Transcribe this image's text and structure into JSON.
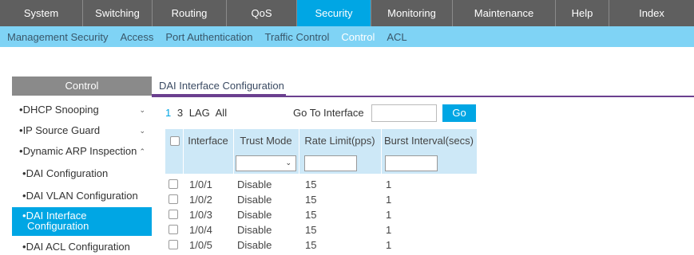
{
  "topnav": {
    "tabs": [
      {
        "label": "System"
      },
      {
        "label": "Switching"
      },
      {
        "label": "Routing"
      },
      {
        "label": "QoS"
      },
      {
        "label": "Security"
      },
      {
        "label": "Monitoring"
      },
      {
        "label": "Maintenance"
      },
      {
        "label": "Help"
      },
      {
        "label": "Index"
      }
    ],
    "active": "Security"
  },
  "subnav": {
    "items": [
      {
        "label": "Management Security"
      },
      {
        "label": "Access"
      },
      {
        "label": "Port Authentication"
      },
      {
        "label": "Traffic Control"
      },
      {
        "label": "Control"
      },
      {
        "label": "ACL"
      }
    ],
    "active": "Control"
  },
  "sidebar": {
    "header": "Control",
    "items": [
      {
        "label": "DHCP Snooping",
        "bullet": "•"
      },
      {
        "label": "IP Source Guard",
        "bullet": "•"
      },
      {
        "label": "Dynamic ARP Inspection",
        "bullet": "•"
      },
      {
        "label": "DAI Configuration",
        "bullet": "•"
      },
      {
        "label": "DAI VLAN Configuration",
        "bullet": "•"
      },
      {
        "label": "DAI Interface Configuration",
        "label_line1": "DAI Interface",
        "label_line2": "Configuration",
        "bullet": "•"
      },
      {
        "label": "DAI ACL Configuration",
        "bullet": "•"
      }
    ]
  },
  "main": {
    "tab_title": "DAI Interface Configuration",
    "pager": [
      "1",
      "3",
      "LAG",
      "All"
    ],
    "goto_label": "Go To Interface",
    "goto_value": "",
    "go_button": "Go"
  },
  "table": {
    "headers": [
      "Interface",
      "Trust Mode",
      "Rate Limit(pps)",
      "Burst Interval(secs)"
    ],
    "filter_trust_mode": "",
    "rows": [
      {
        "interface": "1/0/1",
        "trust_mode": "Disable",
        "rate_limit": "15",
        "burst_interval": "1"
      },
      {
        "interface": "1/0/2",
        "trust_mode": "Disable",
        "rate_limit": "15",
        "burst_interval": "1"
      },
      {
        "interface": "1/0/3",
        "trust_mode": "Disable",
        "rate_limit": "15",
        "burst_interval": "1"
      },
      {
        "interface": "1/0/4",
        "trust_mode": "Disable",
        "rate_limit": "15",
        "burst_interval": "1"
      },
      {
        "interface": "1/0/5",
        "trust_mode": "Disable",
        "rate_limit": "15",
        "burst_interval": "1"
      }
    ]
  },
  "colors": {
    "accent": "#00a6e4",
    "topnav_bg": "#5f5f5f",
    "subnav_bg": "#7fd3f5",
    "table_header_bg": "#cde8f7",
    "tab_underline": "#6b3f8f"
  }
}
